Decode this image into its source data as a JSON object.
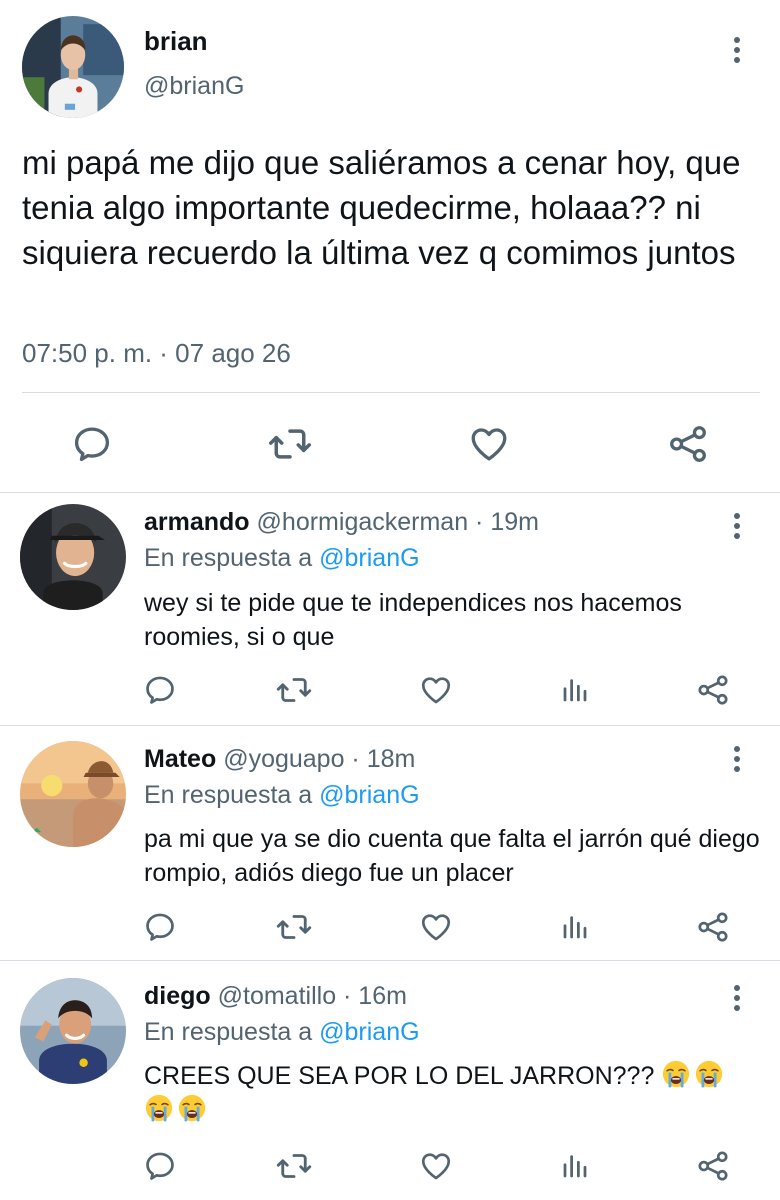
{
  "main_tweet": {
    "name": "brian",
    "handle": "@brianG",
    "text": "mi papá me dijo que saliéramos a cenar hoy, que tenia algo importante quedecirme, holaaa?? ni siquiera recuerdo la última vez q comimos juntos",
    "timestamp": "07:50 p. m. · 07 ago 26",
    "actions": [
      "reply-icon",
      "retweet-icon",
      "like-icon",
      "share-icon"
    ]
  },
  "replies": [
    {
      "name": "armando",
      "meta": "@hormigackerman · 19m",
      "reply_prefix": "En respuesta a",
      "reply_mention": "@brianG",
      "text": "wey si te pide que te independices nos hacemos roomies, si o que"
    },
    {
      "name": "Mateo",
      "meta": "@yoguapo · 18m",
      "reply_prefix": "En respuesta a",
      "reply_mention": "@brianG",
      "text": "pa mi que ya se dio cuenta que falta el jarrón qué diego rompio, adiós diego fue un placer"
    },
    {
      "name": "diego",
      "meta": "@tomatillo · 16m",
      "reply_prefix": "En respuesta a",
      "reply_mention": "@brianG",
      "text": "CREES QUE SEA POR LO DEL JARRON???",
      "emojis": [
        "loudly-crying-face",
        "loudly-crying-face",
        "loudly-crying-face",
        "loudly-crying-face"
      ]
    }
  ],
  "colors": {
    "text": "#0f1419",
    "secondary": "#536471",
    "mention": "#1d9bf0",
    "divider": "#d8dee3"
  }
}
